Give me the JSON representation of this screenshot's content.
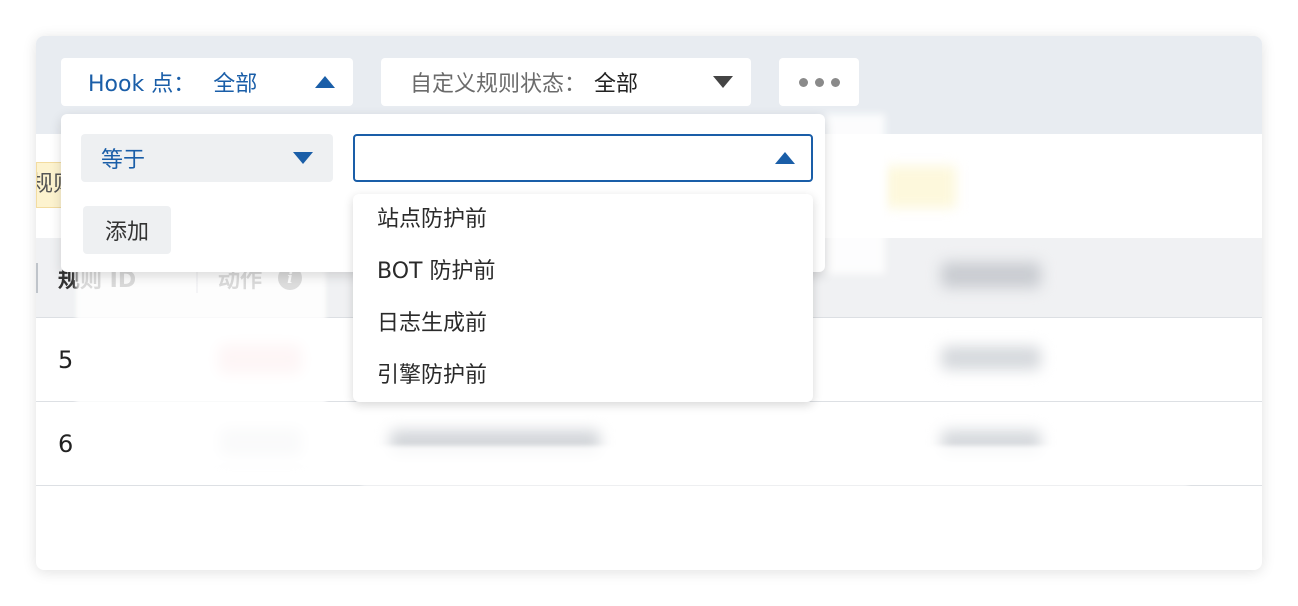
{
  "filters": {
    "hook": {
      "label": "Hook 点：",
      "value": "全部"
    },
    "status": {
      "label": "自定义规则状态：",
      "value": "全部"
    },
    "more_label": "•••"
  },
  "panel": {
    "operator": "等于",
    "value": "",
    "add_label": "添加",
    "options": [
      "站点防护前",
      "BOT 防护前",
      "日志生成前",
      "引擎防护前"
    ]
  },
  "table": {
    "hint_text": "规则",
    "headers": {
      "id": "规则 ID",
      "action": "动作"
    },
    "rows": [
      {
        "id": "5"
      },
      {
        "id": "6"
      }
    ]
  },
  "colors": {
    "accent": "#1a5ea8",
    "filter_band": "#e8ecf1"
  }
}
